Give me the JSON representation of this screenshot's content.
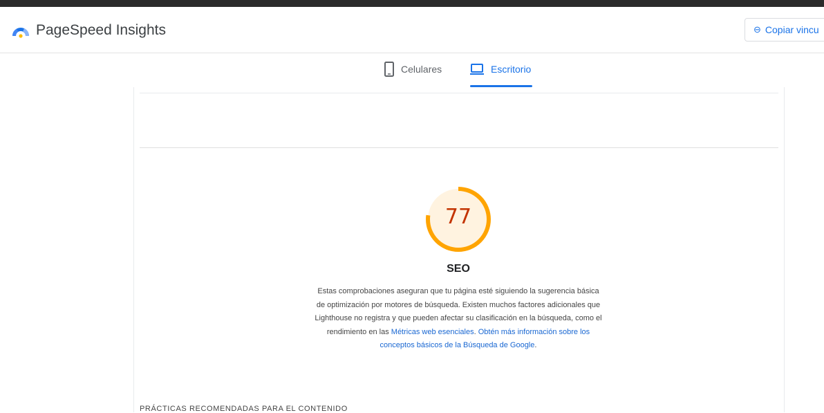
{
  "header": {
    "brand": "PageSpeed Insights",
    "logo_icon": "pagespeed-logo-icon",
    "copy_link_label": "Copiar vincu",
    "copy_link_icon": "link-icon"
  },
  "tabs": [
    {
      "label": "Celulares",
      "icon": "mobile-phone-icon",
      "selected": false
    },
    {
      "label": "Escritorio",
      "icon": "laptop-icon",
      "selected": true
    }
  ],
  "category": {
    "score": "77",
    "title": "SEO",
    "description_prefix": "Estas comprobaciones aseguran que tu página esté siguiendo la sugerencia básica de optimización por motores de búsqueda. Existen muchos factores adicionales que Lighthouse no registra y que pueden afectar su clasificación en la búsqueda, como el rendimiento en las ",
    "link1": "Métricas web esenciales",
    "between": ". ",
    "link2": "Obtén más información sobre los conceptos básicos de la Búsqueda de Google",
    "suffix": "."
  },
  "section_heading": "PRÁCTICAS RECOMENDADAS PARA EL CONTENIDO",
  "colors": {
    "accent": "#1a73e8",
    "score_average": "#ffa400",
    "score_text": "#c33300"
  }
}
